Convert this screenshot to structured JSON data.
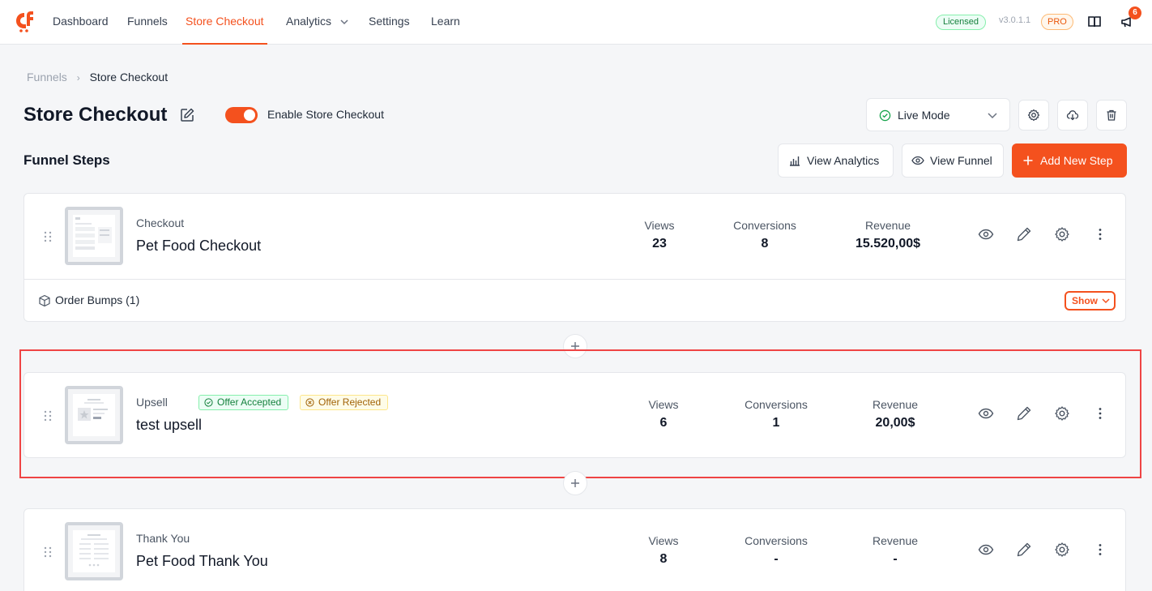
{
  "nav": {
    "items": [
      "Dashboard",
      "Funnels",
      "Store Checkout",
      "Analytics",
      "Settings",
      "Learn"
    ],
    "active": "Store Checkout",
    "licensed": "Licensed",
    "version": "v3.0.1.1",
    "pro": "PRO",
    "notifications": "6",
    "accent": "#f4511e"
  },
  "breadcrumb": {
    "parent": "Funnels",
    "current": "Store Checkout"
  },
  "header": {
    "title": "Store Checkout",
    "toggle_label": "Enable Store Checkout",
    "toggle_on": true,
    "mode": "Live Mode"
  },
  "steps_section": {
    "title": "Funnel Steps",
    "view_analytics": "View Analytics",
    "view_funnel": "View Funnel",
    "add_step": "Add New Step"
  },
  "steps": [
    {
      "type": "Checkout",
      "name": "Pet Food Checkout",
      "views_label": "Views",
      "views": "23",
      "conversions_label": "Conversions",
      "conversions": "8",
      "revenue_label": "Revenue",
      "revenue": "15.520,00$",
      "order_bumps": "Order Bumps (1)",
      "show": "Show"
    },
    {
      "type": "Upsell",
      "tag_accepted": "Offer Accepted",
      "tag_rejected": "Offer Rejected",
      "name": "test upsell",
      "views_label": "Views",
      "views": "6",
      "conversions_label": "Conversions",
      "conversions": "1",
      "revenue_label": "Revenue",
      "revenue": "20,00$"
    },
    {
      "type": "Thank You",
      "name": "Pet Food Thank You",
      "views_label": "Views",
      "views": "8",
      "conversions_label": "Conversions",
      "conversions": "-",
      "revenue_label": "Revenue",
      "revenue": "-"
    }
  ]
}
